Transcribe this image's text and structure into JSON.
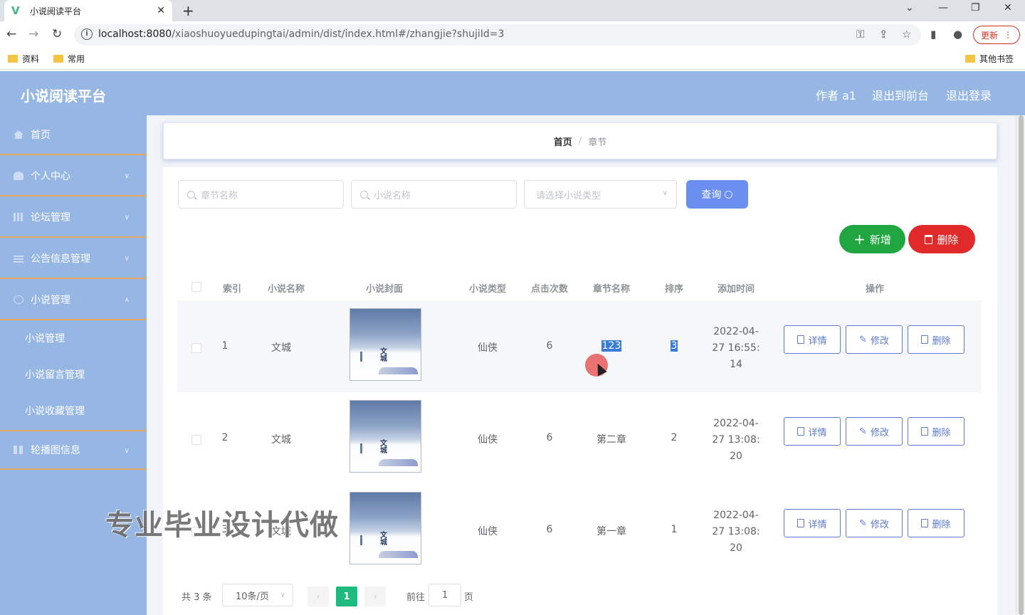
{
  "browser": {
    "tab_title": "小说阅读平台",
    "tab_logo": "V",
    "url_host": "localhost:8080",
    "url_path": "/xiaoshuoyuedupingtai/admin/dist/index.html#/zhangjie?shujiId=3",
    "update_label": "更新",
    "bookmarks": [
      "资料",
      "常用"
    ],
    "other_bookmarks": "其他书签"
  },
  "header": {
    "title": "小说阅读平台",
    "author": "作者 a1",
    "to_front": "退出到前台",
    "logout": "退出登录"
  },
  "sidebar": {
    "items": [
      {
        "label": "首页",
        "icon": "home-icon",
        "expandable": false
      },
      {
        "label": "个人中心",
        "icon": "user-icon",
        "expandable": true
      },
      {
        "label": "论坛管理",
        "icon": "forum-icon",
        "expandable": true
      },
      {
        "label": "公告信息管理",
        "icon": "notice-icon",
        "expandable": true
      },
      {
        "label": "小说管理",
        "icon": "book-icon",
        "expandable": true
      }
    ],
    "sub_items": [
      "小说管理",
      "小说留言管理",
      "小说收藏管理"
    ],
    "last_item": {
      "label": "轮播图信息",
      "icon": "carousel-icon"
    }
  },
  "breadcrumb": {
    "home": "首页",
    "separator": "/",
    "current": "章节"
  },
  "search": {
    "chapter_placeholder": "章节名称",
    "novel_placeholder": "小说名称",
    "type_placeholder": "请选择小说类型",
    "query_label": "查询"
  },
  "actions": {
    "add_label": "新增",
    "delete_label": "删除"
  },
  "table": {
    "headers": [
      "索引",
      "小说名称",
      "小说封面",
      "小说类型",
      "点击次数",
      "章节名称",
      "排序",
      "添加时间",
      "操作"
    ],
    "cover_title": "文城",
    "rows": [
      {
        "index": "1",
        "novel": "文城",
        "type": "仙侠",
        "clicks": "6",
        "chapter": "123",
        "order": "3",
        "time_l1": "2022-04-",
        "time_l2": "27 16:55:",
        "time_l3": "14"
      },
      {
        "index": "2",
        "novel": "文城",
        "type": "仙侠",
        "clicks": "6",
        "chapter": "第二章",
        "order": "2",
        "time_l1": "2022-04-",
        "time_l2": "27 13:08:",
        "time_l3": "20"
      },
      {
        "index": "3",
        "novel": "文城",
        "type": "仙侠",
        "clicks": "6",
        "chapter": "第一章",
        "order": "1",
        "time_l1": "2022-04-",
        "time_l2": "27 13:08:",
        "time_l3": "20"
      }
    ],
    "op_detail": "详情",
    "op_edit": "修改",
    "op_delete": "删除"
  },
  "pagination": {
    "total": "共 3 条",
    "page_size": "10条/页",
    "current_page": "1",
    "goto_label": "前往",
    "goto_value": "1",
    "page_suffix": "页"
  },
  "watermark": "专业毕业设计代做",
  "colors": {
    "header_bg": "#96b6e3",
    "add_btn": "#1fa640",
    "delete_btn": "#e02a2a",
    "query_btn": "#6b8ff0",
    "active_page": "#1fba7f"
  }
}
